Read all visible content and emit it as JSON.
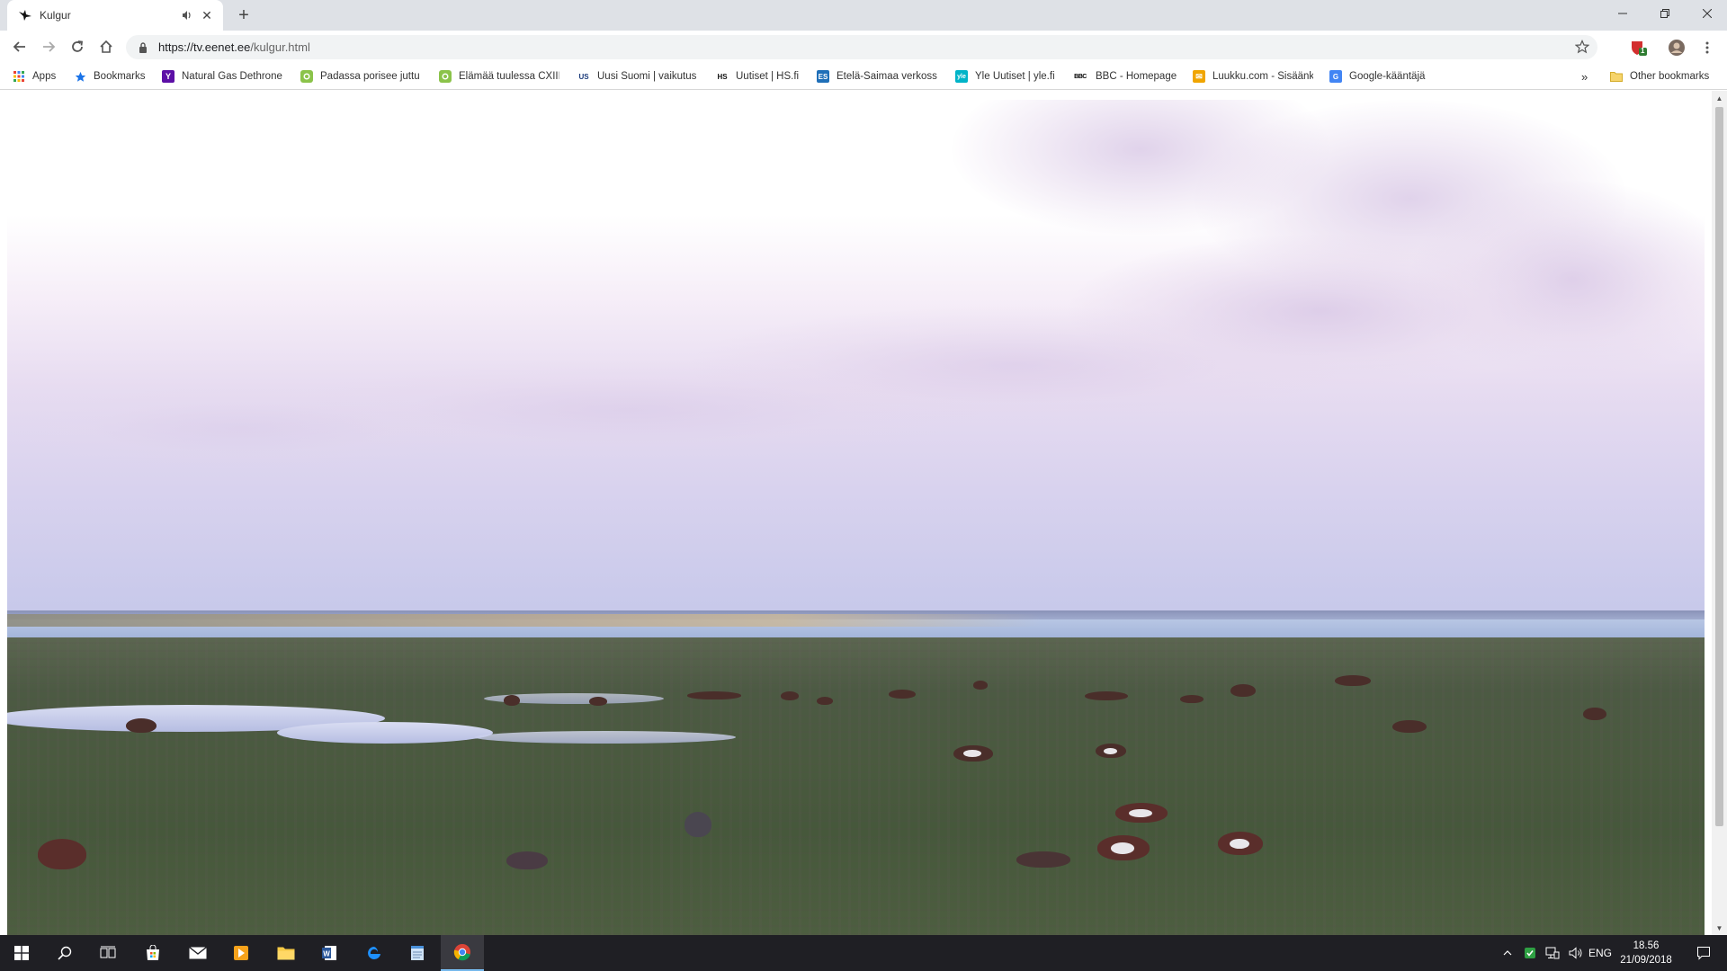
{
  "tab": {
    "title": "Kulgur",
    "close_glyph": "✕",
    "audio_glyph": "🔈"
  },
  "newtab_glyph": "+",
  "window": {
    "minimize": "—",
    "maximize": "❐",
    "close": "✕"
  },
  "toolbar": {
    "url_host": "https://tv.eenet.ee",
    "url_path": "/kulgur.html",
    "extension_badge": "1"
  },
  "bookmarks": [
    {
      "label": "Apps",
      "icon": "apps-grid-icon"
    },
    {
      "label": "Bookmarks",
      "icon": "star-icon"
    },
    {
      "label": "Natural Gas Dethrone",
      "icon": "yahoo-icon",
      "glyph": "Y",
      "color": "#5c0fa6"
    },
    {
      "label": "Padassa porisee juttu",
      "icon": "green-site-icon",
      "glyph": "●",
      "color": "#8bc34a"
    },
    {
      "label": "Elämää tuulessa CXIII",
      "icon": "green-site-icon",
      "glyph": "●",
      "color": "#8bc34a"
    },
    {
      "label": "Uusi Suomi | vaikutus",
      "icon": "us-icon",
      "glyph": "US",
      "color": "#1a3a7a"
    },
    {
      "label": "Uutiset | HS.fi",
      "icon": "hs-icon",
      "glyph": "HS",
      "color": "#111111"
    },
    {
      "label": "Etelä-Saimaa verkoss",
      "icon": "es-icon",
      "glyph": "ES",
      "color": "#1f6fb8"
    },
    {
      "label": "Yle Uutiset | yle.fi",
      "icon": "yle-icon",
      "glyph": "yle",
      "color": "#00b4c8"
    },
    {
      "label": "BBC - Homepage",
      "icon": "bbc-icon",
      "glyph": "BBC",
      "color": "#000000"
    },
    {
      "label": "Luukku.com - Sisäänk",
      "icon": "mail-icon",
      "glyph": "✉",
      "color": "#f0a500"
    },
    {
      "label": "Google-kääntäjä",
      "icon": "translate-icon",
      "glyph": "G",
      "color": "#4285f4"
    }
  ],
  "bookmarks_overflow": "»",
  "other_bookmarks": "Other bookmarks",
  "taskbar": {
    "language": "ENG",
    "time": "18.56",
    "date": "21/09/2018"
  },
  "colors": {
    "tabstrip": "#dee1e6",
    "taskbar": "#1f1f24",
    "omnibox": "#f1f3f4"
  }
}
